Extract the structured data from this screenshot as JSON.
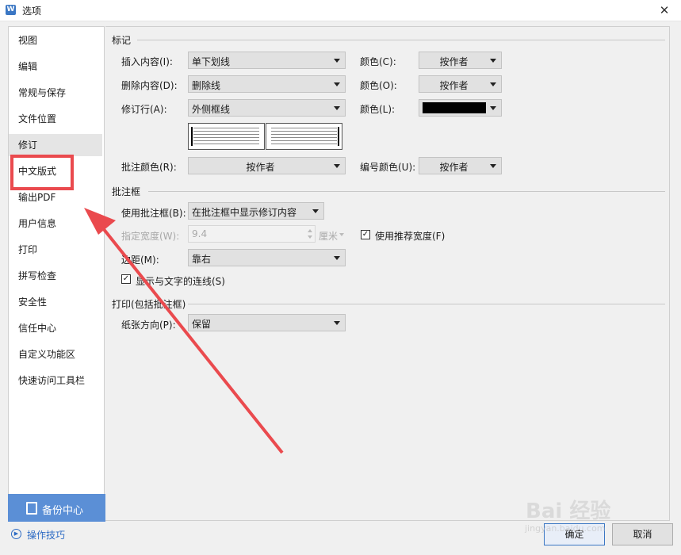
{
  "window": {
    "title": "选项",
    "app_icon": "W"
  },
  "sidebar": {
    "items": [
      {
        "label": "视图"
      },
      {
        "label": "编辑"
      },
      {
        "label": "常规与保存"
      },
      {
        "label": "文件位置"
      },
      {
        "label": "修订"
      },
      {
        "label": "中文版式"
      },
      {
        "label": "输出PDF"
      },
      {
        "label": "用户信息"
      },
      {
        "label": "打印"
      },
      {
        "label": "拼写检查"
      },
      {
        "label": "安全性"
      },
      {
        "label": "信任中心"
      },
      {
        "label": "自定义功能区"
      },
      {
        "label": "快速访问工具栏"
      }
    ],
    "selected": "修订",
    "backup_label": "备份中心",
    "tips_label": "操作技巧"
  },
  "markup": {
    "section_title": "标记",
    "insert_label": "插入内容(I):",
    "insert_value": "单下划线",
    "insert_color_label": "颜色(C):",
    "insert_color_value": "按作者",
    "delete_label": "删除内容(D):",
    "delete_value": "删除线",
    "delete_color_label": "颜色(O):",
    "delete_color_value": "按作者",
    "revline_label": "修订行(A):",
    "revline_value": "外侧框线",
    "revline_color_label": "颜色(L):",
    "revline_color_value": "#000000",
    "comment_color_label": "批注颜色(R):",
    "comment_color_value": "按作者",
    "number_color_label": "编号颜色(U):",
    "number_color_value": "按作者"
  },
  "balloon": {
    "section_title": "批注框",
    "use_label": "使用批注框(B):",
    "use_value": "在批注框中显示修订内容",
    "width_label": "指定宽度(W):",
    "width_value": "9.4",
    "width_unit": "厘米",
    "recommend_label": "使用推荐宽度(F)",
    "recommend_checked": true,
    "margin_label": "边距(M):",
    "margin_value": "靠右",
    "connect_label": "显示与文字的连线(S)",
    "connect_checked": true
  },
  "print": {
    "section_title": "打印(包括批注框)",
    "orientation_label": "纸张方向(P):",
    "orientation_value": "保留"
  },
  "buttons": {
    "ok": "确定",
    "cancel": "取消"
  },
  "watermark": {
    "text": "Bai 经验",
    "sub": "jingyan.baidu.com"
  },
  "colors": {
    "accent": "#5b8fd6",
    "annotation": "#ea4a4e",
    "selected_bg": "#e5e5e5"
  }
}
